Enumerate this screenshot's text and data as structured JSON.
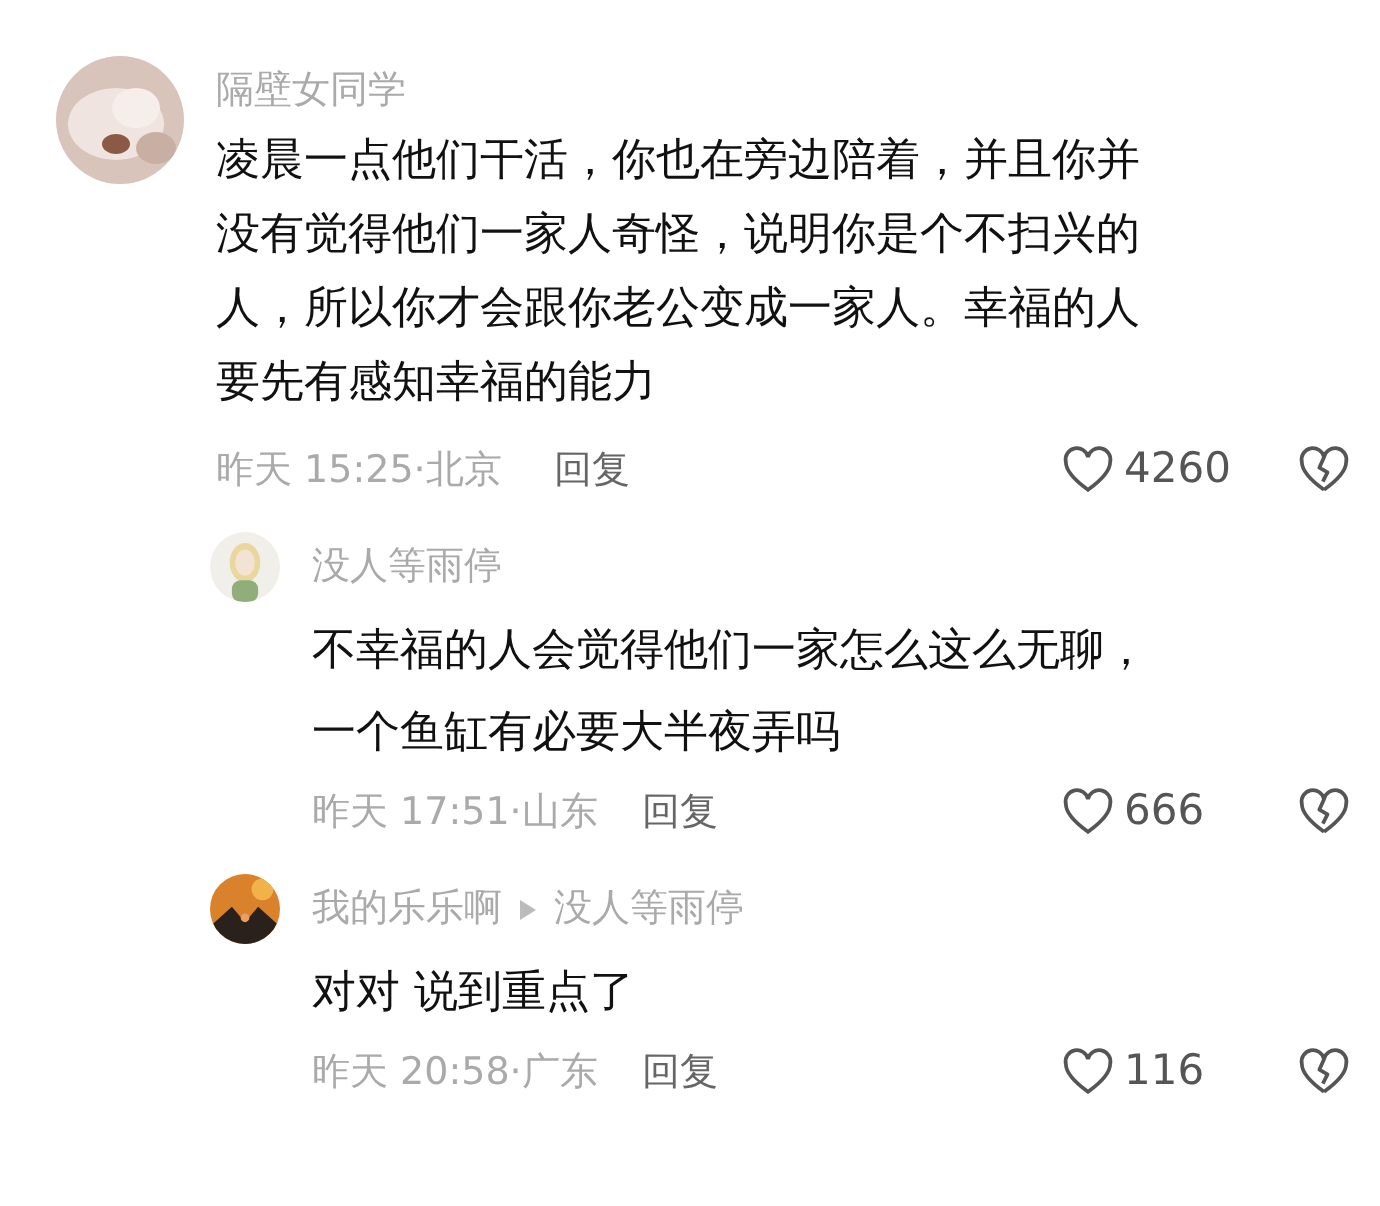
{
  "comments": [
    {
      "user": "隔壁女同学",
      "text": "凌晨一点他们干活，你也在旁边陪着，并且你并没有觉得他们一家人奇怪，说明你是个不扫兴的人，所以你才会跟你老公变成一家人。幸福的人要先有感知幸福的能力",
      "meta": "昨天 15:25·北京",
      "reply_label": "回复",
      "likes": "4260",
      "replies": [
        {
          "user": "没人等雨停",
          "text": "不幸福的人会觉得他们一家怎么这么无聊，一个鱼缸有必要大半夜弄吗",
          "meta": "昨天 17:51·山东",
          "reply_label": "回复",
          "likes": "666"
        },
        {
          "user": "我的乐乐啊",
          "reply_to": "没人等雨停",
          "text": "对对 说到重点了",
          "meta": "昨天 20:58·广东",
          "reply_label": "回复",
          "likes": "116"
        }
      ]
    }
  ]
}
